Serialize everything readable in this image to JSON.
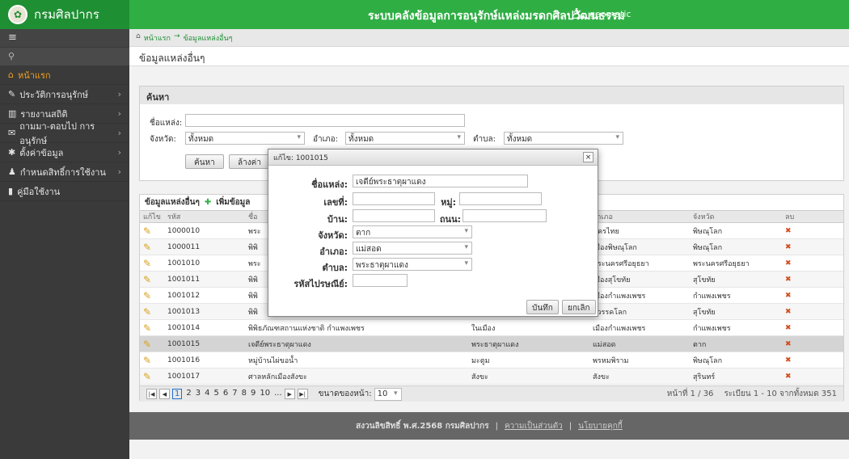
{
  "header": {
    "org_name": "กรมศิลปากร",
    "system_title": "ระบบคลังข้อมูลการอนุรักษ์แหล่งมรดกศิลปวัฒนธรรม",
    "username": "geomatic"
  },
  "sidebar": {
    "menu_icon": "≡",
    "search_icon": "⚲",
    "items": [
      {
        "label": "หน้าแรก",
        "icon": "home-icon",
        "glyph": "⌂",
        "arrow": ""
      },
      {
        "label": "ประวัติการอนุรักษ์",
        "icon": "edit-icon",
        "glyph": "✎",
        "arrow": "›"
      },
      {
        "label": "รายงานสถิติ",
        "icon": "chart-icon",
        "glyph": "▥",
        "arrow": "›"
      },
      {
        "label": "ถามมา-ตอบไป การอนุรักษ์",
        "icon": "chat-icon",
        "glyph": "✉",
        "arrow": "›"
      },
      {
        "label": "ตั้งค่าข้อมูล",
        "icon": "gear-icon",
        "glyph": "✱",
        "arrow": "›"
      },
      {
        "label": "กำหนดสิทธิ์การใช้งาน",
        "icon": "user-icon",
        "glyph": "♟",
        "arrow": "›"
      },
      {
        "label": "คู่มือใช้งาน",
        "icon": "book-icon",
        "glyph": "▮",
        "arrow": ""
      }
    ]
  },
  "breadcrumb": {
    "home": "หน้าแรก",
    "sep": "→",
    "current": "ข้อมูลแหล่งอื่นๆ"
  },
  "page_title": "ข้อมูลแหล่งอื่นๆ",
  "search": {
    "title": "ค้นหา",
    "name_label": "ชื่อแหล่ง:",
    "name_value": "",
    "province_label": "จังหวัด:",
    "province_value": "ทั้งหมด",
    "district_label": "อำเภอ:",
    "district_value": "ทั้งหมด",
    "subdistrict_label": "ตำบล:",
    "subdistrict_value": "ทั้งหมด",
    "search_button": "ค้นหา",
    "clear_button": "ล้างค่า"
  },
  "grid": {
    "title": "ข้อมูลแหล่งอื่นๆ",
    "add_label": "เพิ่มข้อมูล",
    "columns": [
      "แก้ไข",
      "รหัส",
      "ชื่อ",
      "",
      "อำเภอ",
      "จังหวัด",
      "ลบ"
    ],
    "rows": [
      {
        "code": "1000010",
        "name": "พระ",
        "sub": "",
        "district": "นครไทย",
        "province": "พิษณุโลก"
      },
      {
        "code": "1000011",
        "name": "พิพิ",
        "sub": "",
        "district": "เมืองพิษณุโลก",
        "province": "พิษณุโลก"
      },
      {
        "code": "1001010",
        "name": "พระ",
        "sub": "",
        "district": "พระนครศรีอยุธยา",
        "province": "พระนครศรีอยุธยา"
      },
      {
        "code": "1001011",
        "name": "พิพิ",
        "sub": "",
        "district": "เมืองสุโขทัย",
        "province": "สุโขทัย"
      },
      {
        "code": "1001012",
        "name": "พิพิ",
        "sub": "",
        "district": "เมืองกำแพงเพชร",
        "province": "กำแพงเพชร"
      },
      {
        "code": "1001013",
        "name": "พิพิ",
        "sub": "",
        "district": "สวรรคโลก",
        "province": "สุโขทัย"
      },
      {
        "code": "1001014",
        "name": "พิพิธภัณฑสถานแห่งชาติ กำแพงเพชร",
        "sub": "ในเมือง",
        "district": "เมืองกำแพงเพชร",
        "province": "กำแพงเพชร"
      },
      {
        "code": "1001015",
        "name": "เจดีย์พระธาตุผาแดง",
        "sub": "พระธาตุผาแดง",
        "district": "แม่สอด",
        "province": "ตาก"
      },
      {
        "code": "1001016",
        "name": "หมู่บ้านไผ่ขอน้ำ",
        "sub": "มะตูม",
        "district": "พรหมพิราม",
        "province": "พิษณุโลก"
      },
      {
        "code": "1001017",
        "name": "ศาลหลักเมืองสังขะ",
        "sub": "สังขะ",
        "district": "สังขะ",
        "province": "สุรินทร์"
      }
    ],
    "pager": {
      "pages": [
        "1",
        "2",
        "3",
        "4",
        "5",
        "6",
        "7",
        "8",
        "9",
        "10",
        "..."
      ],
      "page_size_label": "ขนาดของหน้า:",
      "page_size": "10",
      "page_info": "หน้าที่ 1 / 36",
      "record_info": "ระเบียน 1 - 10 จากทั้งหมด 351"
    }
  },
  "footer": {
    "copyright": "สงวนลิขสิทธิ์ พ.ศ.2568 กรมศิลปากร",
    "privacy": "ความเป็นส่วนตัว",
    "policy": "นโยบายคุกกี้"
  },
  "modal": {
    "title": "แก้ไข: 1001015",
    "close": "×",
    "name_label": "ชื่อแหล่ง:",
    "name_value": "เจดีย์พระธาตุผาแดง",
    "house_label": "เลขที่:",
    "house_value": "",
    "moo_label": "หมู่:",
    "moo_value": "",
    "village_label": "บ้าน:",
    "village_value": "",
    "road_label": "ถนน:",
    "road_value": "",
    "province_label": "จังหวัด:",
    "province_value": "ตาก",
    "district_label": "อำเภอ:",
    "district_value": "แม่สอด",
    "subdistrict_label": "ตำบล:",
    "subdistrict_value": "พระธาตุผาแดง",
    "postcode_label": "รหัสไปรษณีย์:",
    "postcode_value": "",
    "save_button": "บันทึก",
    "cancel_button": "ยกเลิก"
  },
  "colors": {
    "header_green": "#2fae44",
    "sidebar": "#3a3a3a",
    "active_menu": "#f0a020"
  }
}
